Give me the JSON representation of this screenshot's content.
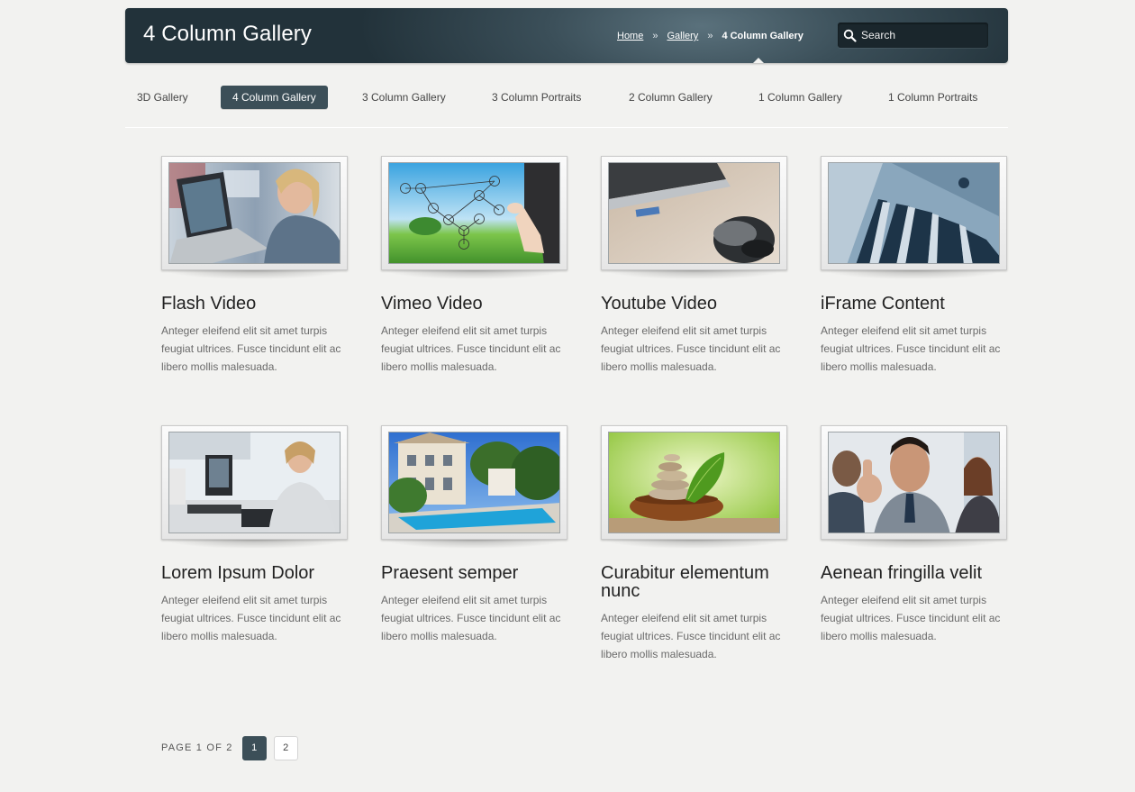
{
  "header": {
    "title": "4 Column Gallery",
    "breadcrumb": [
      {
        "label": "Home"
      },
      {
        "label": "Gallery"
      },
      {
        "label": "4 Column Gallery"
      }
    ],
    "separator": "»",
    "search_placeholder": "Search"
  },
  "filters": [
    {
      "label": "3D Gallery",
      "active": false
    },
    {
      "label": "4 Column Gallery",
      "active": true
    },
    {
      "label": "3 Column Gallery",
      "active": false
    },
    {
      "label": "3 Column Portraits",
      "active": false
    },
    {
      "label": "2 Column Gallery",
      "active": false
    },
    {
      "label": "1 Column Gallery",
      "active": false
    },
    {
      "label": "1 Column Portraits",
      "active": false
    }
  ],
  "items": [
    {
      "title": "Flash Video",
      "desc": "Anteger eleifend elit sit amet turpis feugiat ultrices. Fusce tincidunt elit ac libero mollis malesuada.",
      "image": "woman-with-laptop"
    },
    {
      "title": "Vimeo Video",
      "desc": "Anteger eleifend elit sit amet turpis feugiat ultrices. Fusce tincidunt elit ac libero mollis malesuada.",
      "image": "hand-drawing-network"
    },
    {
      "title": "Youtube Video",
      "desc": "Anteger eleifend elit sit amet turpis feugiat ultrices. Fusce tincidunt elit ac libero mollis malesuada.",
      "image": "computer-mouse-and-laptop"
    },
    {
      "title": "iFrame Content",
      "desc": "Anteger eleifend elit sit amet turpis feugiat ultrices. Fusce tincidunt elit ac libero mollis malesuada.",
      "image": "spiral-staircase"
    },
    {
      "title": "Lorem Ipsum Dolor",
      "desc": "Anteger eleifend elit sit amet turpis feugiat ultrices. Fusce tincidunt elit ac libero mollis malesuada.",
      "image": "call-center-office"
    },
    {
      "title": "Praesent semper",
      "desc": "Anteger eleifend elit sit amet turpis feugiat ultrices. Fusce tincidunt elit ac libero mollis malesuada.",
      "image": "villa-with-pool"
    },
    {
      "title": "Curabitur elementum nunc",
      "desc": "Anteger eleifend elit sit amet turpis feugiat ultrices. Fusce tincidunt elit ac libero mollis malesuada.",
      "image": "zen-stones-and-leaf"
    },
    {
      "title": "Aenean fringilla velit",
      "desc": "Anteger eleifend elit sit amet turpis feugiat ultrices. Fusce tincidunt elit ac libero mollis malesuada.",
      "image": "smiling-businessman-team"
    }
  ],
  "pagination": {
    "label": "PAGE 1 OF 2",
    "pages": [
      {
        "label": "1",
        "active": true
      },
      {
        "label": "2",
        "active": false
      }
    ]
  },
  "colors": {
    "header_dark": "#22323a",
    "accent": "#3c4f58",
    "background": "#f2f2f0"
  }
}
